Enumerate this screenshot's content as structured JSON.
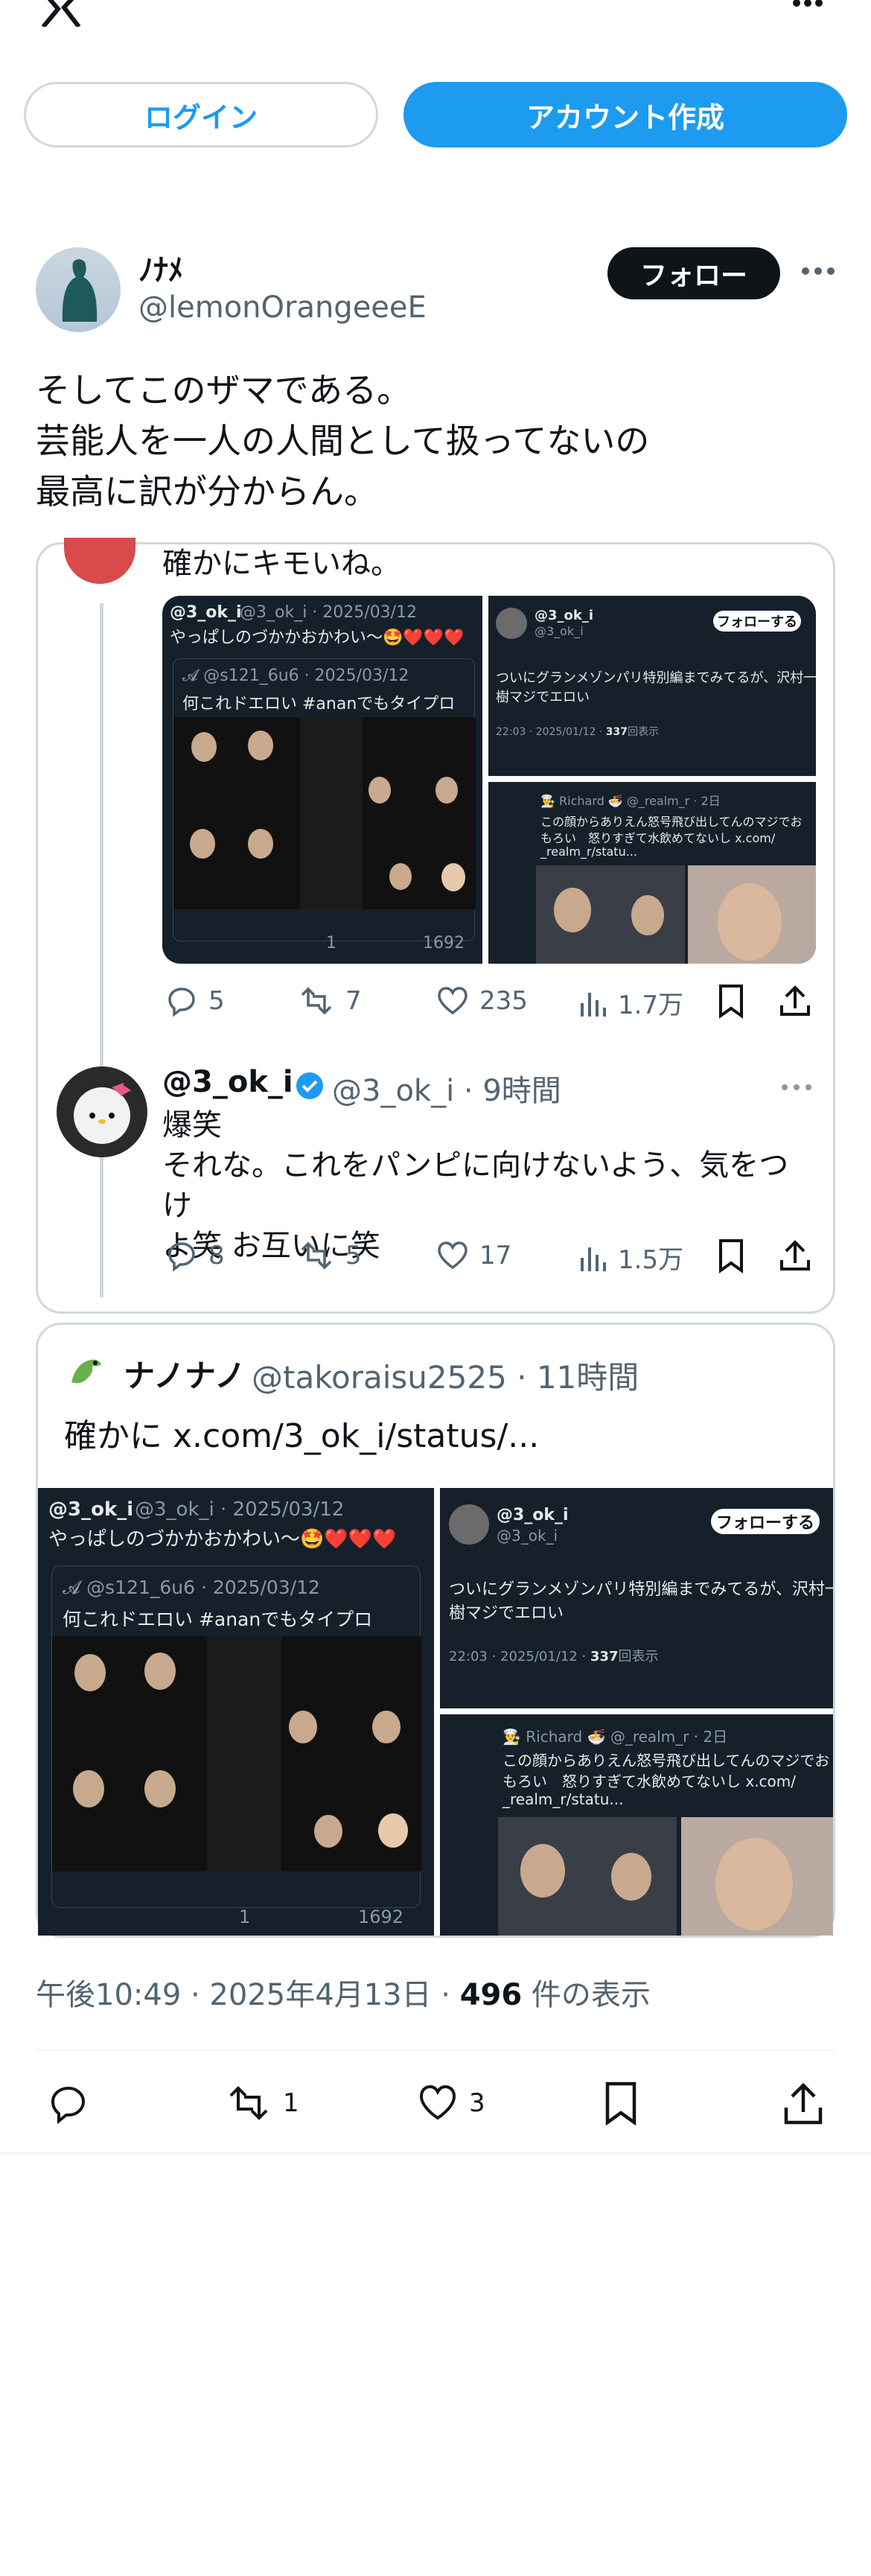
{
  "header": {
    "login_label": "ログイン",
    "signup_label": "アカウント作成"
  },
  "tweet": {
    "author_name": "ﾉﾅﾒ",
    "author_handle": "@lemonOrangeeeE",
    "follow_label": "フォロー",
    "text": "そしてこのザマである。\n芸能人を一人の人間として扱ってないの\n最高に訳が分からん。",
    "timestamp": "午後10:49 · 2025年4月13日 · ",
    "views_count": "496",
    "views_label": " 件の表示",
    "actions": {
      "retweets": "1",
      "likes": "3"
    }
  },
  "quote1": {
    "prev_text": "確かにキモいね。",
    "prev_actions": {
      "replies": "5",
      "retweets": "7",
      "likes": "235",
      "views": "1.7万"
    },
    "media": {
      "left": {
        "name": "@3_ok_i",
        "meta": "@3_ok_i · 2025/03/12",
        "text": "やっぱしのづかかおかわい〜🤩❤️❤️❤️",
        "inner_meta": "𝓐 @s121_6u6 · 2025/03/12",
        "inner_text": "何これドエロい #ananでもタイプロ",
        "likes": "1",
        "views": "1692"
      },
      "top_right": {
        "name": "@3_ok_i",
        "handle": "@3_ok_i",
        "follow": "フォローする",
        "text1": "ついにグランメゾンパリ特別編までみてるが、沢村一",
        "text2": "樹マジでエロい",
        "time": "22:03 · 2025/01/12 · ",
        "views": "337",
        "views_label": "回表示"
      },
      "bottom_right": {
        "meta": "👨‍🍳 Richard 🍜 @_realm_r · 2日",
        "text1": "この顔からありえん怒号飛び出してんのマジでお",
        "text2": "もろい　怒りすぎて水飲めてないし x.com/",
        "text3": "_realm_r/statu..."
      }
    },
    "reply": {
      "name": "@3_ok_i",
      "meta": "@3_ok_i · 9時間",
      "text": "爆笑\nそれな。これをパンピに向けないよう、気をつけ\nよ笑 お互いに笑",
      "actions": {
        "replies": "8",
        "retweets": "5",
        "likes": "17",
        "views": "1.5万"
      }
    }
  },
  "quote2": {
    "name": "ナノナノ",
    "meta": "@takoraisu2525 · 11時間",
    "text": "確かに  x.com/3_ok_i/status/..."
  },
  "colors": {
    "accent": "#1d9bf0",
    "text": "#0f1419",
    "muted": "#536471",
    "border": "#cfd9de",
    "dark_bg": "#15202b"
  }
}
